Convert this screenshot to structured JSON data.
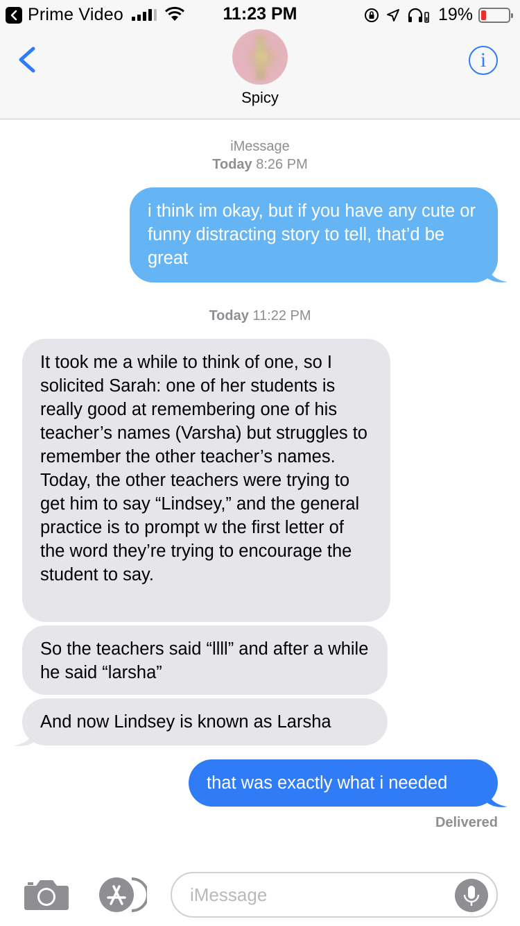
{
  "status_bar": {
    "back_app": "Prime Video",
    "time": "11:23 PM",
    "battery_percent": "19%",
    "battery_level": 0.19
  },
  "nav": {
    "contact_name": "Spicy",
    "info_glyph": "i"
  },
  "conversation": {
    "service_label": "iMessage",
    "timestamp_1_day": "Today",
    "timestamp_1_time": "8:26 PM",
    "timestamp_2_day": "Today",
    "timestamp_2_time": "11:22 PM",
    "messages": [
      {
        "direction": "outgoing",
        "text": "i think im okay, but if you have any cute or funny distracting story to tell, that’d be great"
      },
      {
        "direction": "incoming",
        "text": "It took me a while to think of one, so I solicited Sarah: one of her students is really good at remembering one of his teacher’s names (Varsha) but struggles to remember the other teacher’s names. Today, the other teachers were trying to get him to say “Lindsey,” and the general practice is to prompt w the first letter of the word they’re trying to encourage the student to say."
      },
      {
        "direction": "incoming",
        "text": "So the teachers said “llll” and after a while he said “larsha”"
      },
      {
        "direction": "incoming",
        "text": "And now Lindsey is known as Larsha"
      },
      {
        "direction": "outgoing",
        "text": "that was exactly what i needed"
      }
    ],
    "delivery_status": "Delivered"
  },
  "input_bar": {
    "placeholder": "iMessage",
    "value": ""
  },
  "icons": {
    "status_back": "chevron-left-icon",
    "nav_back": "chevron-left-icon",
    "info": "info-icon",
    "camera": "camera-icon",
    "apps": "app-store-icon",
    "mic": "microphone-icon"
  },
  "colors": {
    "accent": "#2f7cf6",
    "outgoing_sent": "#65b5f5",
    "outgoing_latest": "#2f7cf6",
    "incoming": "#e5e5ea",
    "battery_low": "#e8302b"
  }
}
